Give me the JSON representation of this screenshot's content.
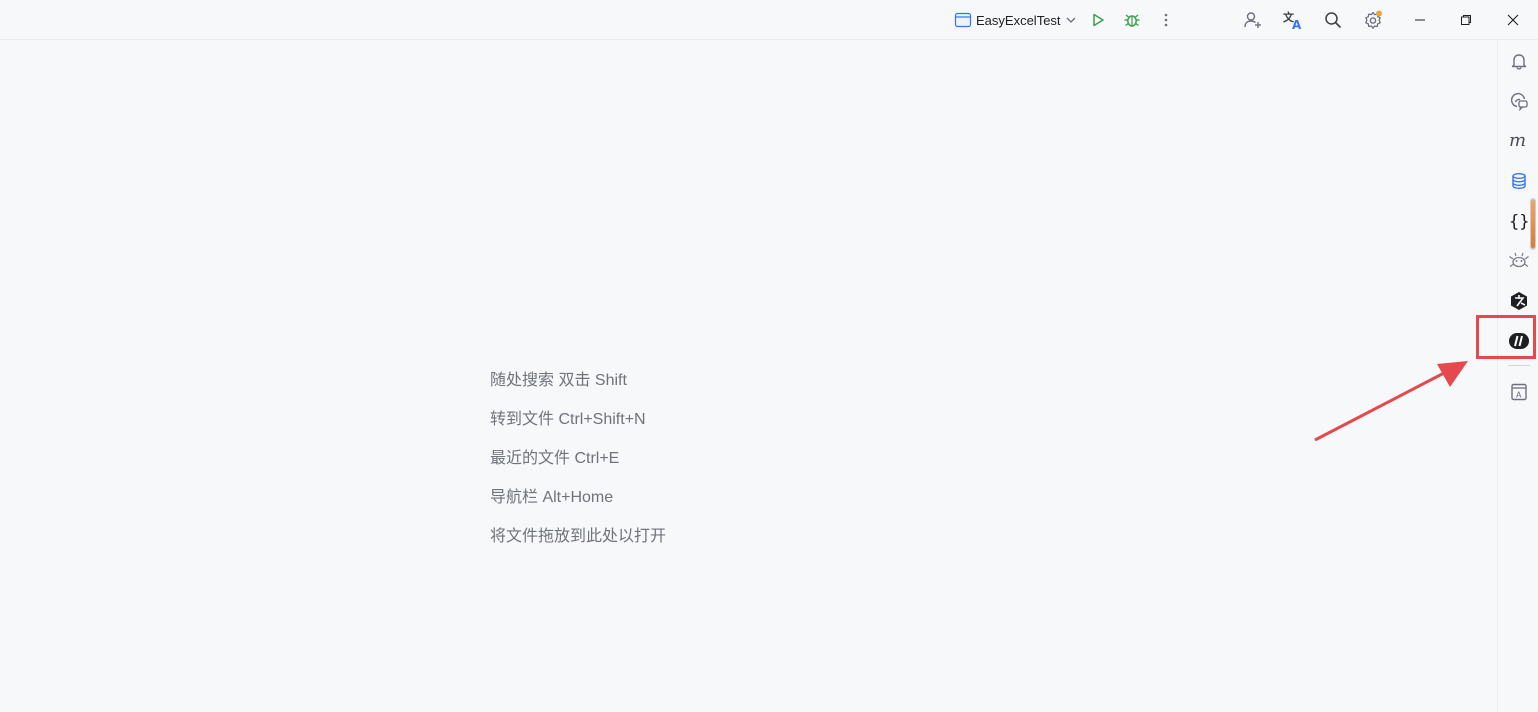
{
  "titlebar": {
    "run_config_name": "EasyExcelTest",
    "icons": {
      "run": "run-icon",
      "debug": "debug-icon",
      "more": "more-vertical-icon",
      "add_user": "add-user-icon",
      "translate": "translate-icon",
      "search": "search-icon",
      "settings": "settings-icon"
    },
    "settings_badge_color": "#f0a33a",
    "window_controls": [
      "minimize",
      "restore",
      "close"
    ]
  },
  "right_toolbar": {
    "items": [
      "notifications-icon",
      "ai-assistant-icon",
      "maven-icon",
      "database-icon",
      "json-icon",
      "mybatis-icon",
      "plugin-icon",
      "jrebel-icon",
      "bookmarks-icon"
    ],
    "highlighted_item": "jrebel-icon"
  },
  "editor": {
    "empty_hints": [
      "随处搜索 双击 Shift",
      "转到文件 Ctrl+Shift+N",
      "最近的文件 Ctrl+E",
      "导航栏 Alt+Home",
      "将文件拖放到此处以打开"
    ]
  },
  "colors": {
    "background": "#f7f8fa",
    "run_green": "#3d9e4a",
    "accent_blue": "#3574f0",
    "annotation_red": "#e5484d",
    "hint_gray": "#6f737a"
  }
}
